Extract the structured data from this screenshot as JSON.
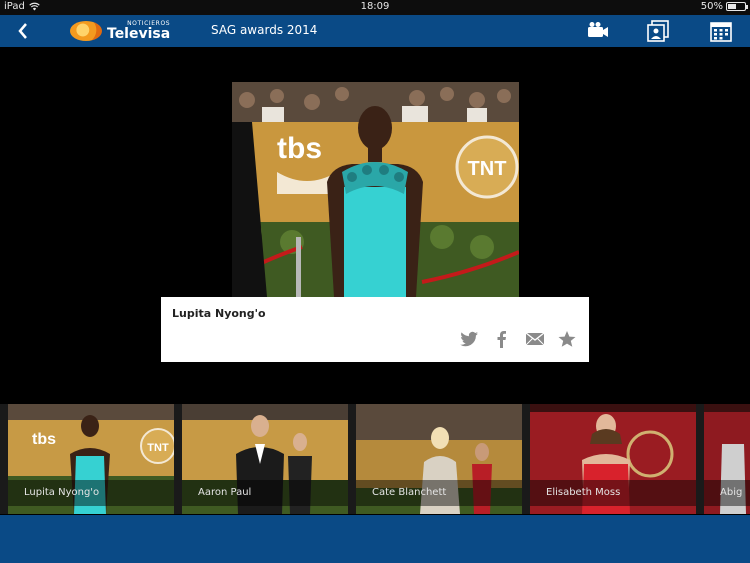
{
  "status_bar": {
    "carrier": "iPad",
    "time": "18:09",
    "battery": "50%",
    "battery_level": 0.5
  },
  "nav": {
    "logo_small": "NOTICIEROS",
    "logo_big": "Televisa",
    "title": "SAG awards 2014",
    "icons": [
      "back-chevron",
      "video-camera-icon",
      "photo-gallery-icon",
      "calendar-icon"
    ]
  },
  "photo": {
    "caption_name": "Lupita Nyong'o",
    "backdrop_text": [
      "tbs",
      "TNT"
    ]
  },
  "share_icons": [
    "twitter-icon",
    "facebook-icon",
    "mail-icon",
    "star-icon"
  ],
  "thumbnails": [
    {
      "label": "Lupita Nyong'o",
      "bg": "#c79a45",
      "dress": "#36d1d2"
    },
    {
      "label": "Aaron Paul",
      "bg": "#c79a45",
      "dress": "#1b1b1b"
    },
    {
      "label": "Cate Blanchett",
      "bg": "#b58a3c",
      "dress": "#d9d1c3"
    },
    {
      "label": "Elisabeth Moss",
      "bg": "#9a1c22",
      "dress": "#d8222c"
    },
    {
      "label": "Abig",
      "bg": "#8e1a20",
      "dress": "#cfcfcf"
    }
  ],
  "colors": {
    "nav_blue": "#0a4a86",
    "card_bg": "#ffffff"
  }
}
